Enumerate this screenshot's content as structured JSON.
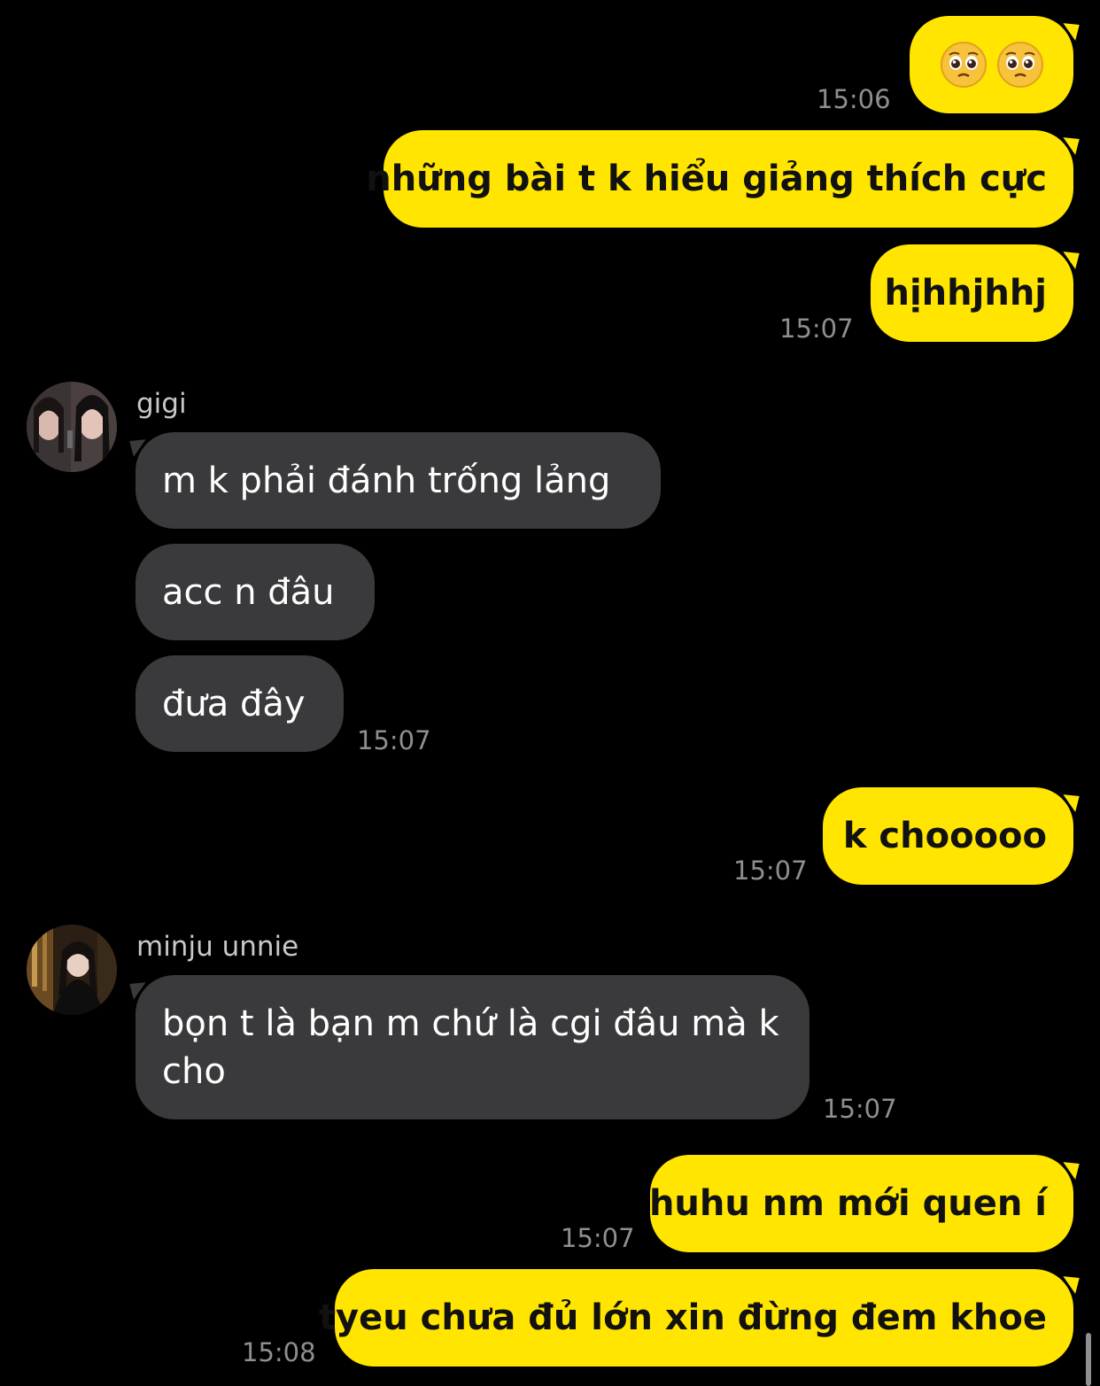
{
  "messages": {
    "m1": {
      "emoji": [
        "pleading-face",
        "pleading-face"
      ],
      "time": "15:06"
    },
    "m2": {
      "text": "những bài t k hiểu giảng thích cực"
    },
    "m3": {
      "text": "hịhhjhhj",
      "time": "15:07"
    },
    "g1": {
      "sender": "gigi",
      "text": "m k phải đánh trống lảng"
    },
    "g2": {
      "text": "acc n đâu"
    },
    "g3": {
      "text": "đưa đây",
      "time": "15:07"
    },
    "m4": {
      "text": "k chooooo",
      "time": "15:07"
    },
    "u1": {
      "sender": "minju unnie",
      "text": "bọn t là bạn m chứ là cgi đâu mà k cho",
      "time": "15:07"
    },
    "m5": {
      "text": "huhu nm mới quen í",
      "time": "15:07"
    },
    "m6": {
      "text": "tyeu chưa đủ lớn xin đừng đem khoe",
      "time": "15:08"
    }
  },
  "colors": {
    "outgoing_bubble": "#FFE500",
    "incoming_bubble": "#3A3A3C",
    "background": "#000000",
    "timestamp": "#8E8E93"
  }
}
